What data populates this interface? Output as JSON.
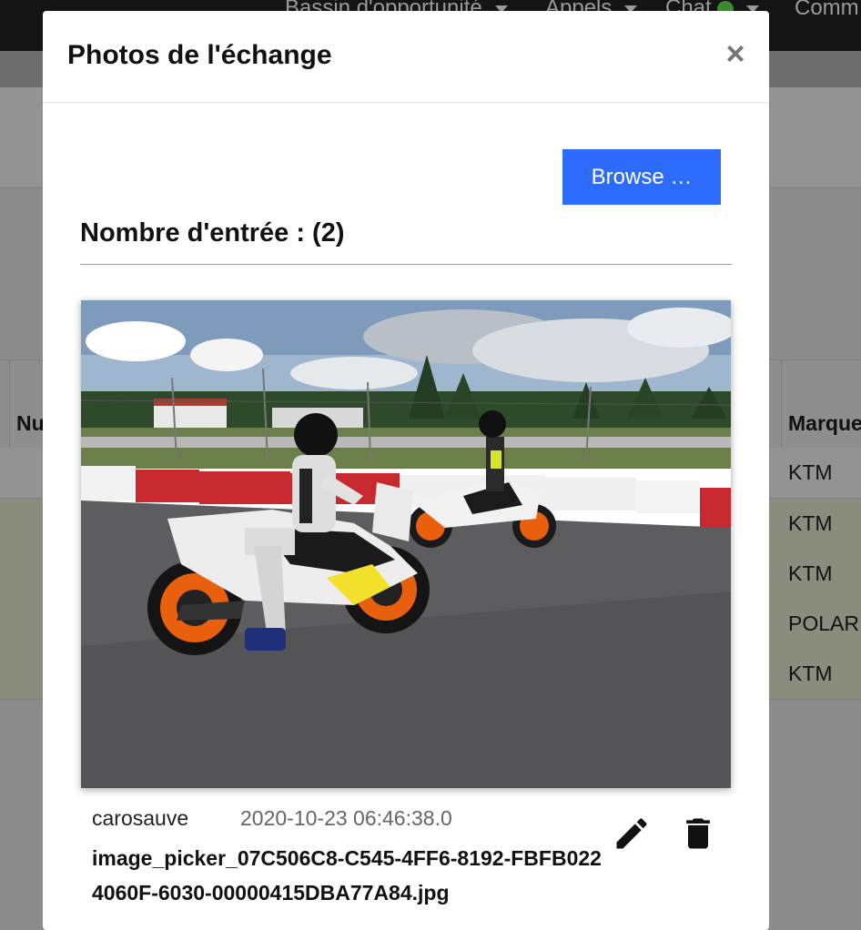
{
  "background": {
    "nav": {
      "item1": "Bassin d'opportunité",
      "item2": "Appels",
      "item3": "Chat",
      "item4": "Comm"
    },
    "table": {
      "col1_header": "Nu",
      "col2_header": "Marque",
      "rows": [
        "KTM",
        "KTM",
        "KTM",
        "POLAR",
        "KTM"
      ]
    }
  },
  "modal": {
    "title": "Photos de l'échange",
    "close_label": "×",
    "browse_label": "Browse …",
    "count_label": "Nombre d'entrée : (2)",
    "photos": [
      {
        "user": "carosauve",
        "date": "2020-10-23 06:46:38.0",
        "filename": "image_picker_07C506C8-C545-4FF6-8192-FBFB0224060F-6030-00000415DBA77A84.jpg"
      }
    ]
  },
  "icons": {
    "close": "close-icon",
    "edit": "pencil-icon",
    "delete": "trash-icon"
  }
}
